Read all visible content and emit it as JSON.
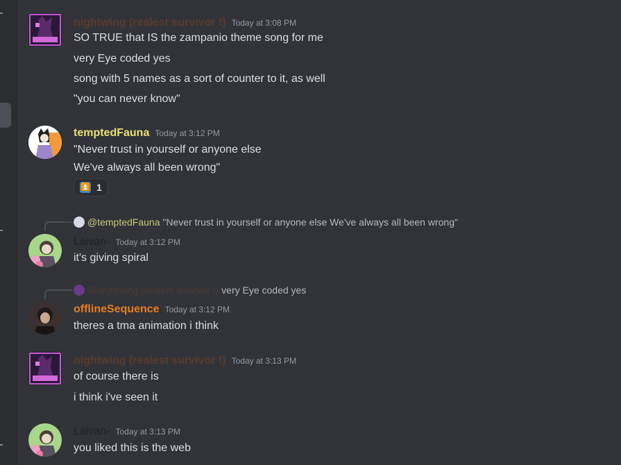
{
  "colors": {
    "background": "#313338",
    "name_nightwing": "#5a3a2e",
    "name_tempted": "#e8e176",
    "name_offline": "#e67e22",
    "name_laivan": "#202225"
  },
  "messages": [
    {
      "author": "nightwing (realest survivor !)",
      "timestamp": "Today at 3:08 PM",
      "lines": [
        "SO TRUE that IS the zampanio theme song for me",
        "very Eye coded yes",
        "song with 5 names as a sort of counter to it, as well",
        "\"you can never know\""
      ]
    },
    {
      "author": "temptedFauna",
      "timestamp": "Today at 3:12 PM",
      "lines": [
        "\"Never trust in yourself or anyone else",
        "We've always all been wrong\""
      ],
      "reaction": {
        "emoji": "⏫",
        "count": "1"
      }
    },
    {
      "reply_mention": "@temptedFauna",
      "reply_text": "\"Never trust in yourself or anyone else We've always all been wrong\"",
      "author": "Laivan-",
      "timestamp": "Today at 3:12 PM",
      "lines": [
        "it's giving spiral"
      ]
    },
    {
      "reply_mention": "@nightwing (realest survivor !)",
      "reply_text": "very Eye coded yes",
      "author": "offlineSequence",
      "timestamp": "Today at 3:12 PM",
      "lines": [
        "theres a tma animation i think"
      ]
    },
    {
      "author": "nightwing (realest survivor !)",
      "timestamp": "Today at 3:13 PM",
      "lines": [
        "of course there is",
        "i think i've seen it"
      ]
    },
    {
      "author": "Laivan-",
      "timestamp": "Today at 3:13 PM",
      "lines": [
        "you liked this is the web"
      ]
    }
  ]
}
